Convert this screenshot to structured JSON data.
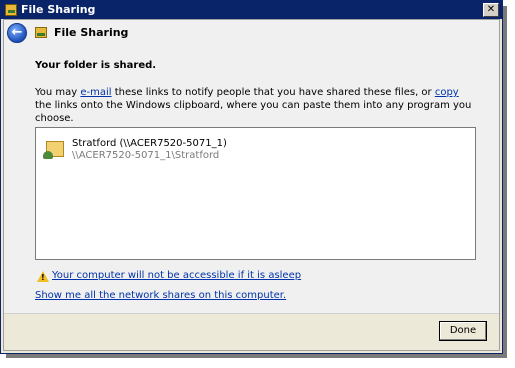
{
  "window": {
    "title": "File Sharing",
    "close_glyph": "✕"
  },
  "nav": {
    "back_glyph": "←",
    "title": "File Sharing"
  },
  "heading": "Your folder is shared.",
  "description": {
    "part1": "You may ",
    "email_link": "e-mail",
    "part2": " these links to notify people that you have shared these files, or ",
    "copy_link": "copy",
    "part3": " the links onto the Windows clipboard, where you can paste them into any program you choose."
  },
  "shared_items": [
    {
      "name": "Stratford (\\\\ACER7520-5071_1)",
      "path": "\\\\ACER7520-5071_1\\Stratford"
    }
  ],
  "warning": {
    "icon": "warning-icon",
    "glyph": "!",
    "text": "Your computer will not be accessible if it is asleep"
  },
  "network_shares_link": "Show me all the network shares on this computer.",
  "footer": {
    "done_label": "Done"
  }
}
